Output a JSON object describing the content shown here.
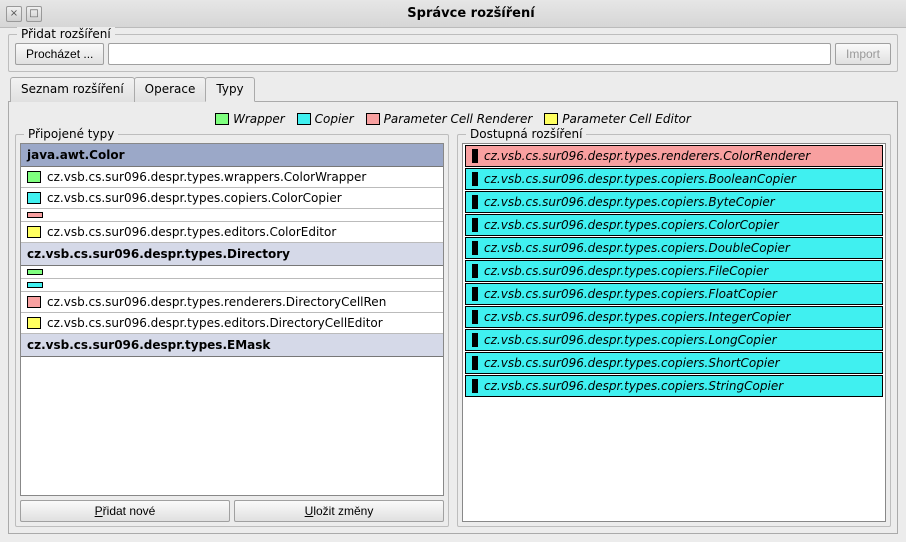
{
  "window": {
    "title": "Správce rozšíření"
  },
  "addExtension": {
    "groupLabel": "Přidat rozšíření",
    "browseLabel": "Procházet ...",
    "pathValue": "",
    "importLabel": "Import"
  },
  "tabs": {
    "list": "Seznam rozšíření",
    "operations": "Operace",
    "types": "Typy"
  },
  "legend": {
    "wrapper": "Wrapper",
    "copier": "Copier",
    "renderer": "Parameter Cell Renderer",
    "editor": "Parameter Cell Editor"
  },
  "leftPanel": {
    "label": "Připojené typy",
    "groups": [
      {
        "header": "java.awt.Color",
        "headerStyle": "dark",
        "rows": [
          {
            "swatch": "wrapper",
            "label": "cz.vsb.cs.sur096.despr.types.wrappers.ColorWrapper"
          },
          {
            "swatch": "copier",
            "label": "cz.vsb.cs.sur096.despr.types.copiers.ColorCopier"
          },
          {
            "swatch": "renderer-tiny",
            "label": ""
          },
          {
            "swatch": "editor",
            "label": "cz.vsb.cs.sur096.despr.types.editors.ColorEditor"
          }
        ]
      },
      {
        "header": "cz.vsb.cs.sur096.despr.types.Directory",
        "headerStyle": "light",
        "rows": [
          {
            "swatch": "wrapper-tiny",
            "label": ""
          },
          {
            "swatch": "copier-tiny",
            "label": ""
          },
          {
            "swatch": "renderer",
            "label": "cz.vsb.cs.sur096.despr.types.renderers.DirectoryCellRen"
          },
          {
            "swatch": "editor",
            "label": "cz.vsb.cs.sur096.despr.types.editors.DirectoryCellEditor"
          }
        ]
      },
      {
        "header": "cz.vsb.cs.sur096.despr.types.EMask",
        "headerStyle": "light",
        "rows": []
      }
    ],
    "addNewLabel": "Přidat nové",
    "saveLabel": "Uložit změny"
  },
  "rightPanel": {
    "label": "Dostupná rozšíření",
    "rows": [
      {
        "kind": "renderer",
        "label": "cz.vsb.cs.sur096.despr.types.renderers.ColorRenderer"
      },
      {
        "kind": "copier",
        "label": "cz.vsb.cs.sur096.despr.types.copiers.BooleanCopier"
      },
      {
        "kind": "copier",
        "label": "cz.vsb.cs.sur096.despr.types.copiers.ByteCopier"
      },
      {
        "kind": "copier",
        "label": "cz.vsb.cs.sur096.despr.types.copiers.ColorCopier"
      },
      {
        "kind": "copier",
        "label": "cz.vsb.cs.sur096.despr.types.copiers.DoubleCopier"
      },
      {
        "kind": "copier",
        "label": "cz.vsb.cs.sur096.despr.types.copiers.FileCopier"
      },
      {
        "kind": "copier",
        "label": "cz.vsb.cs.sur096.despr.types.copiers.FloatCopier"
      },
      {
        "kind": "copier",
        "label": "cz.vsb.cs.sur096.despr.types.copiers.IntegerCopier"
      },
      {
        "kind": "copier",
        "label": "cz.vsb.cs.sur096.despr.types.copiers.LongCopier"
      },
      {
        "kind": "copier",
        "label": "cz.vsb.cs.sur096.despr.types.copiers.ShortCopier"
      },
      {
        "kind": "copier",
        "label": "cz.vsb.cs.sur096.despr.types.copiers.StringCopier"
      }
    ]
  }
}
